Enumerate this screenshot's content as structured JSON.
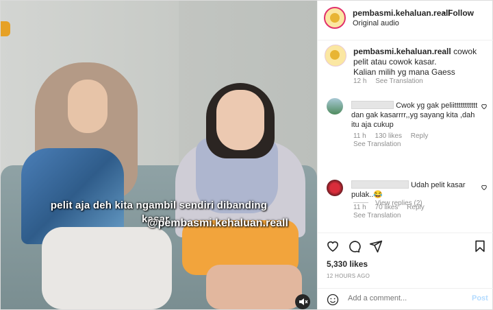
{
  "post": {
    "username": "pembasmi.kehaluan.reall",
    "separator": "•",
    "follow_label": "Follow",
    "audio_label": "Original audio"
  },
  "video": {
    "subtitle_line1": "pelit aja deh kita ngambil sendiri dibanding",
    "subtitle_line2": "kasar",
    "watermark": "@pembasmi.kehaluan.reall",
    "audio_icon": "speaker-muted-icon"
  },
  "caption": {
    "username": "pembasmi.kehaluan.reall",
    "text": "cowok pelit atau cowok kasar.",
    "text2": "Kalian milih yg mana Gaess",
    "time": "12 h",
    "see_translation": "See Translation"
  },
  "comments": [
    {
      "text": "Cwok yg gak peliittttttttttt dan gak kasarrrr,,yg sayang kita ,dah itu aja cukup",
      "time": "11 h",
      "likes": "130 likes",
      "reply": "Reply",
      "see_translation": "See Translation",
      "view_replies": "View replies (2)"
    },
    {
      "text": "Udah pelit kasar pulak..",
      "emoji": "😂",
      "time": "11 h",
      "likes": "70 likes",
      "reply": "Reply",
      "see_translation": "See Translation"
    }
  ],
  "actions": {
    "likes": "5,330 likes",
    "time": "12 HOURS AGO",
    "icons": [
      "heart-icon",
      "comment-icon",
      "share-icon",
      "bookmark-icon"
    ]
  },
  "add_comment": {
    "placeholder": "Add a comment...",
    "post_label": "Post"
  }
}
